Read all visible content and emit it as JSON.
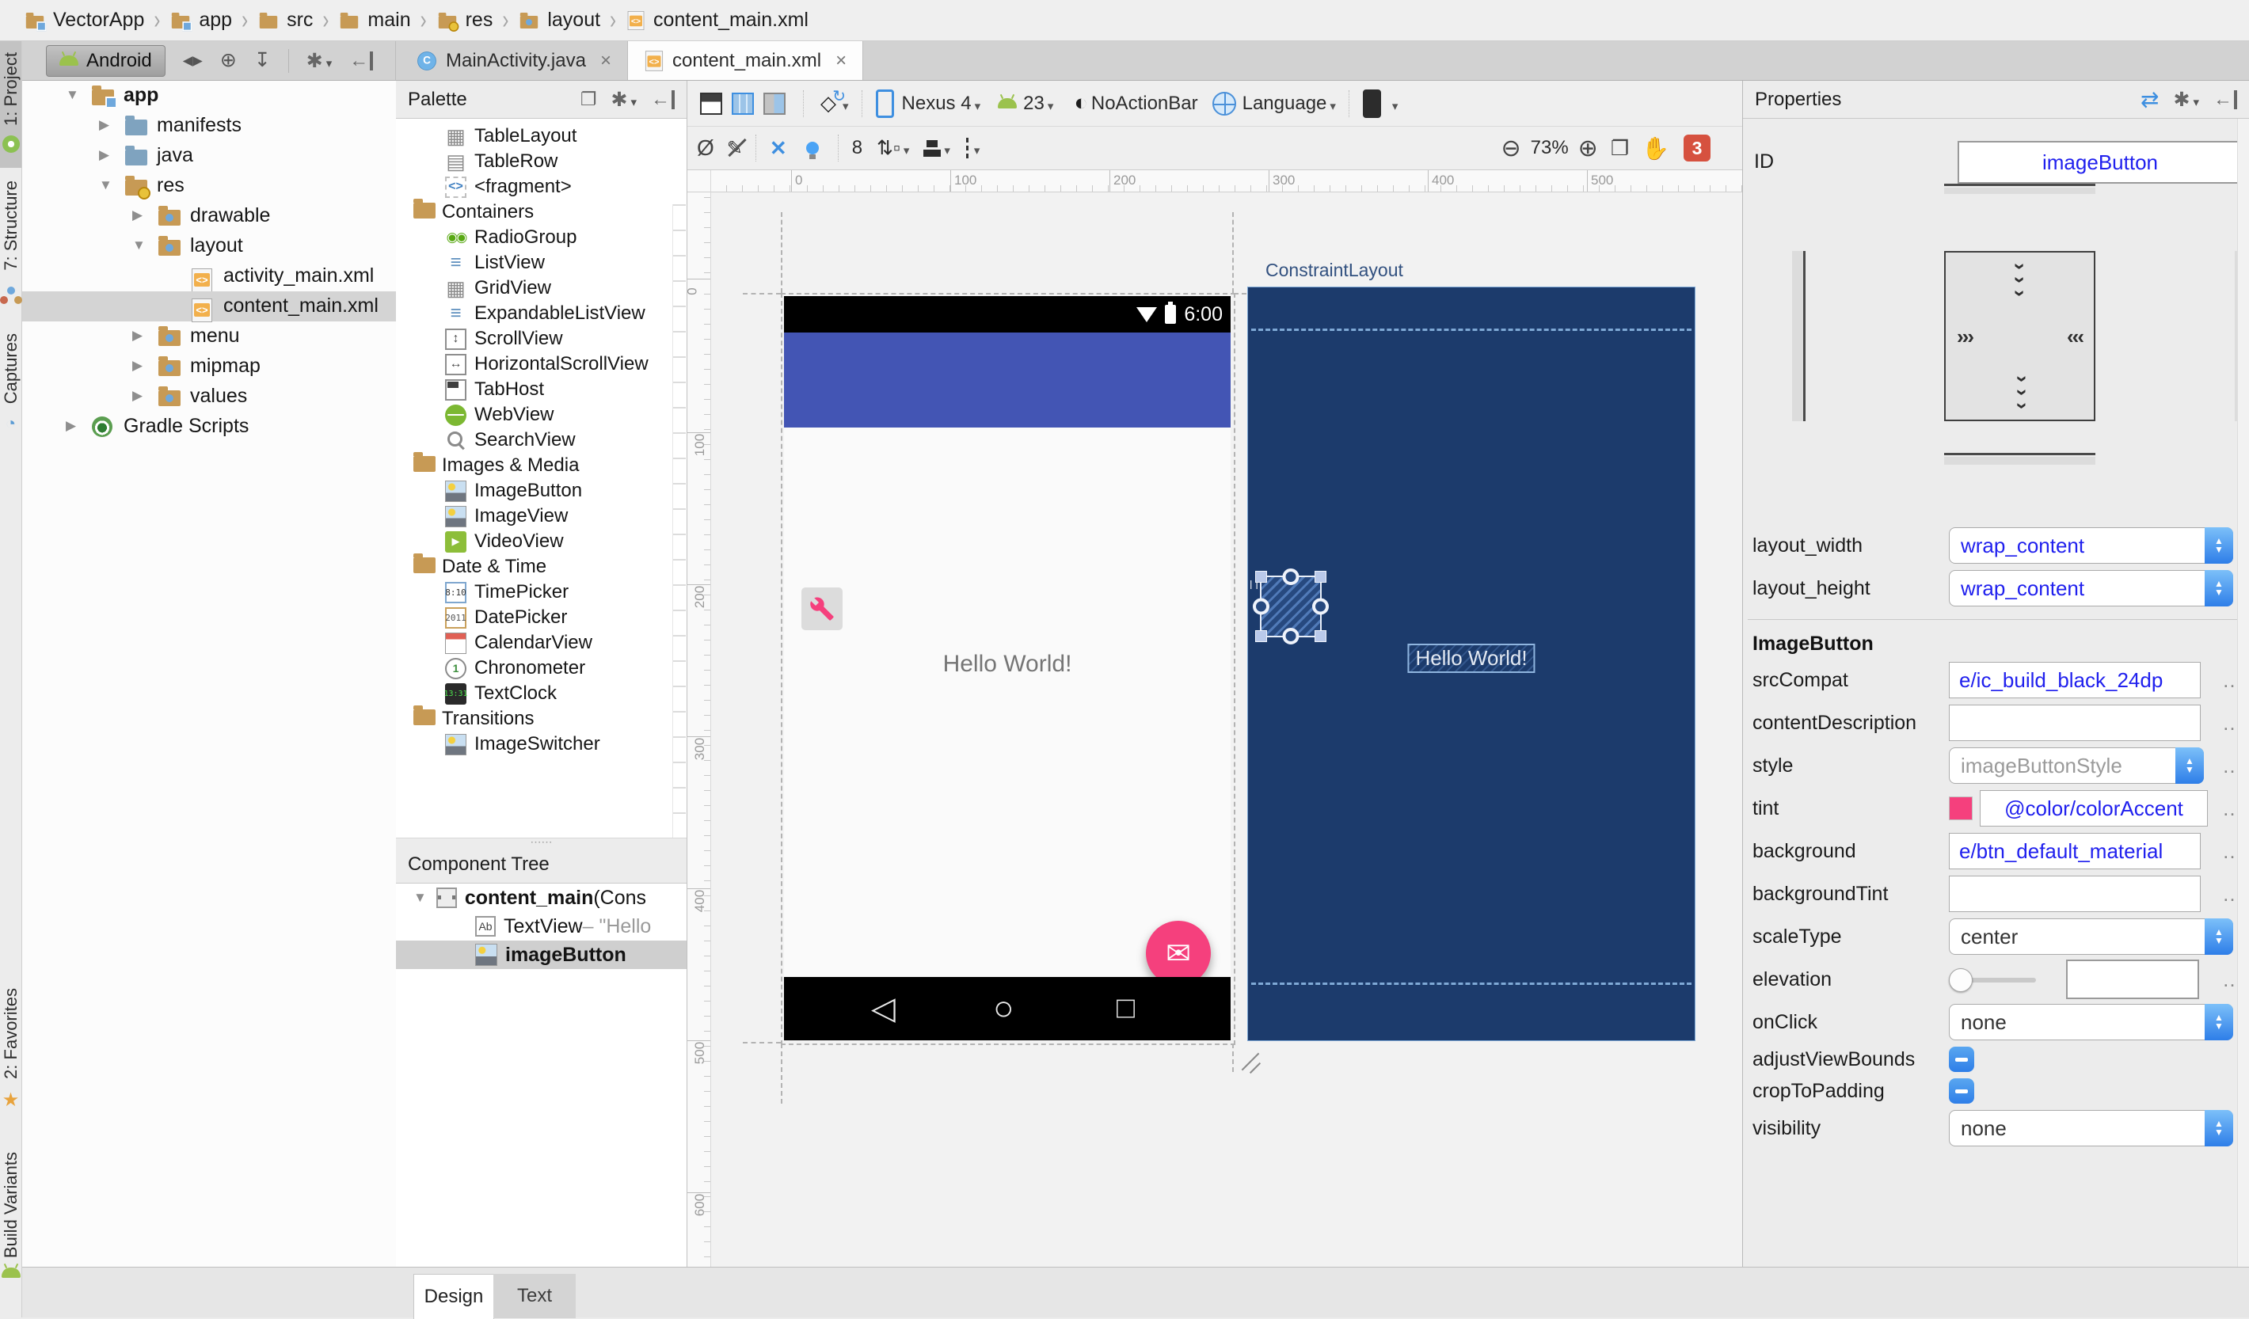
{
  "breadcrumbs": {
    "items": [
      {
        "label": "VectorApp",
        "icon": "project-folder-icon"
      },
      {
        "label": "app",
        "icon": "module-folder-icon"
      },
      {
        "label": "src",
        "icon": "folder-icon"
      },
      {
        "label": "main",
        "icon": "folder-icon"
      },
      {
        "label": "res",
        "icon": "res-folder-icon"
      },
      {
        "label": "layout",
        "icon": "layout-folder-icon"
      },
      {
        "label": "content_main.xml",
        "icon": "xml-file-icon"
      }
    ]
  },
  "project_toolbar": {
    "view_selector": "Android"
  },
  "editor_tabs": [
    {
      "label": "MainActivity.java",
      "icon": "java-class-icon",
      "active": false
    },
    {
      "label": "content_main.xml",
      "icon": "xml-file-icon",
      "active": true
    }
  ],
  "tool_window_bars": {
    "left_top": [
      {
        "label": "1: Project",
        "icon": "android-studio-icon",
        "active": true
      },
      {
        "label": "7: Structure",
        "icon": "structure-icon",
        "active": false
      },
      {
        "label": "Captures",
        "icon": "captures-icon",
        "active": false
      }
    ],
    "left_bottom": [
      {
        "label": "2: Favorites",
        "icon": "star-icon"
      },
      {
        "label": "Build Variants",
        "icon": "android-icon"
      }
    ]
  },
  "project_tree": [
    {
      "label": "app",
      "level": 0,
      "arrow": "down",
      "icon": "folder-app",
      "bold": true
    },
    {
      "label": "manifests",
      "level": 1,
      "arrow": "right",
      "icon": "folder-blue"
    },
    {
      "label": "java",
      "level": 1,
      "arrow": "right",
      "icon": "folder-blue"
    },
    {
      "label": "res",
      "level": 1,
      "arrow": "down",
      "icon": "folder-res"
    },
    {
      "label": "drawable",
      "level": 2,
      "arrow": "right",
      "icon": "folder-dir"
    },
    {
      "label": "layout",
      "level": 2,
      "arrow": "down",
      "icon": "folder-dir"
    },
    {
      "label": "activity_main.xml",
      "level": 3,
      "arrow": "none",
      "icon": "xml-file"
    },
    {
      "label": "content_main.xml",
      "level": 3,
      "arrow": "none",
      "icon": "xml-file",
      "selected": true
    },
    {
      "label": "menu",
      "level": 2,
      "arrow": "right",
      "icon": "folder-dir"
    },
    {
      "label": "mipmap",
      "level": 2,
      "arrow": "right",
      "icon": "folder-dir"
    },
    {
      "label": "values",
      "level": 2,
      "arrow": "right",
      "icon": "folder-dir"
    },
    {
      "label": "Gradle Scripts",
      "level": 0,
      "arrow": "right",
      "icon": "gradle"
    }
  ],
  "palette": {
    "title": "Palette",
    "items": [
      {
        "type": "item",
        "label": "TableLayout",
        "icon": "table-layout-icon"
      },
      {
        "type": "item",
        "label": "TableRow",
        "icon": "table-row-icon"
      },
      {
        "type": "item",
        "label": "<fragment>",
        "icon": "fragment-icon"
      },
      {
        "type": "category",
        "label": "Containers"
      },
      {
        "type": "item",
        "label": "RadioGroup",
        "icon": "radio-group-icon"
      },
      {
        "type": "item",
        "label": "ListView",
        "icon": "list-view-icon"
      },
      {
        "type": "item",
        "label": "GridView",
        "icon": "grid-view-icon"
      },
      {
        "type": "item",
        "label": "ExpandableListView",
        "icon": "expandable-list-icon"
      },
      {
        "type": "item",
        "label": "ScrollView",
        "icon": "scroll-view-icon"
      },
      {
        "type": "item",
        "label": "HorizontalScrollView",
        "icon": "horizontal-scroll-icon"
      },
      {
        "type": "item",
        "label": "TabHost",
        "icon": "tab-host-icon"
      },
      {
        "type": "item",
        "label": "WebView",
        "icon": "web-view-icon"
      },
      {
        "type": "item",
        "label": "SearchView",
        "icon": "search-view-icon"
      },
      {
        "type": "category",
        "label": "Images & Media"
      },
      {
        "type": "item",
        "label": "ImageButton",
        "icon": "image-button-icon"
      },
      {
        "type": "item",
        "label": "ImageView",
        "icon": "image-view-icon"
      },
      {
        "type": "item",
        "label": "VideoView",
        "icon": "video-view-icon"
      },
      {
        "type": "category",
        "label": "Date & Time"
      },
      {
        "type": "item",
        "label": "TimePicker",
        "icon": "time-picker-icon"
      },
      {
        "type": "item",
        "label": "DatePicker",
        "icon": "date-picker-icon"
      },
      {
        "type": "item",
        "label": "CalendarView",
        "icon": "calendar-view-icon"
      },
      {
        "type": "item",
        "label": "Chronometer",
        "icon": "chronometer-icon"
      },
      {
        "type": "item",
        "label": "TextClock",
        "icon": "text-clock-icon"
      },
      {
        "type": "category",
        "label": "Transitions"
      },
      {
        "type": "item",
        "label": "ImageSwitcher",
        "icon": "image-switcher-icon"
      }
    ]
  },
  "component_tree": {
    "title": "Component Tree",
    "items": [
      {
        "arrow": "down",
        "icon": "constraint-layout-icon",
        "selected": false,
        "segments": [
          {
            "text": "content_main",
            "bold": true
          },
          {
            "text": " (Cons",
            "bold": false
          }
        ]
      },
      {
        "arrow": "none",
        "icon": "textview-icon",
        "selected": false,
        "segments": [
          {
            "text": "TextView",
            "bold": false
          },
          {
            "text": " – \"Hello",
            "muted": true
          }
        ]
      },
      {
        "arrow": "none",
        "icon": "image-button-icon",
        "selected": true,
        "segments": [
          {
            "text": "imageButton",
            "bold": true
          }
        ]
      }
    ]
  },
  "design_toolbar": {
    "device": "Nexus 4",
    "api_level": "23",
    "theme": "NoActionBar",
    "locale": "Language",
    "default_margin": "8",
    "zoom_level": "73%",
    "error_count": "3"
  },
  "canvas": {
    "h_ruler": [
      "0",
      "100",
      "200",
      "300",
      "400",
      "500"
    ],
    "v_ruler": [
      "0",
      "100",
      "200",
      "300",
      "400",
      "500",
      "600"
    ],
    "constraint_label": "ConstraintLayout",
    "design_preview": {
      "status_time": "6:00",
      "hello_text": "Hello World!"
    },
    "blueprint": {
      "hello_text": "Hello World!",
      "clipped_label": "l i"
    }
  },
  "properties": {
    "title": "Properties",
    "id_label": "ID",
    "id_value": "imageButton",
    "rows": [
      {
        "label": "layout_width",
        "kind": "dropdown",
        "value": "wrap_content",
        "value_color": "blue"
      },
      {
        "label": "layout_height",
        "kind": "dropdown",
        "value": "wrap_content",
        "value_color": "blue"
      },
      {
        "kind": "separator"
      },
      {
        "kind": "header",
        "label": "ImageButton"
      },
      {
        "label": "srcCompat",
        "kind": "input",
        "value": "e/ic_build_black_24dp",
        "value_color": "blue",
        "dots": true
      },
      {
        "label": "contentDescription",
        "kind": "input",
        "value": "",
        "dots": true
      },
      {
        "label": "style",
        "kind": "dropdown",
        "value": "imageButtonStyle",
        "value_color": "gray",
        "dots": true
      },
      {
        "label": "tint",
        "kind": "swatch-input",
        "value": "@color/colorAccent",
        "value_color": "blue",
        "dots": true
      },
      {
        "label": "background",
        "kind": "input",
        "value": "e/btn_default_material",
        "value_color": "blue",
        "dots": true
      },
      {
        "label": "backgroundTint",
        "kind": "input",
        "value": "",
        "dots": true
      },
      {
        "label": "scaleType",
        "kind": "dropdown",
        "value": "center",
        "value_color": "black"
      },
      {
        "label": "elevation",
        "kind": "slider-input",
        "value": "",
        "dots": true
      },
      {
        "label": "onClick",
        "kind": "dropdown",
        "value": "none",
        "value_color": "black"
      },
      {
        "label": "adjustViewBounds",
        "kind": "toggle"
      },
      {
        "label": "cropToPadding",
        "kind": "toggle"
      },
      {
        "label": "visibility",
        "kind": "dropdown",
        "value": "none",
        "value_color": "black"
      }
    ]
  },
  "bottom_tabs": [
    {
      "label": "Design",
      "active": true
    },
    {
      "label": "Text",
      "active": false
    }
  ],
  "colors": {
    "accent_pink": "#F5407D",
    "appbar_blue": "#4355B4",
    "blueprint_navy": "#1C3B6C",
    "value_text_blue": "#2020EE",
    "error_badge_red": "#D6513F",
    "selection_gray": "#D4D4D4"
  }
}
